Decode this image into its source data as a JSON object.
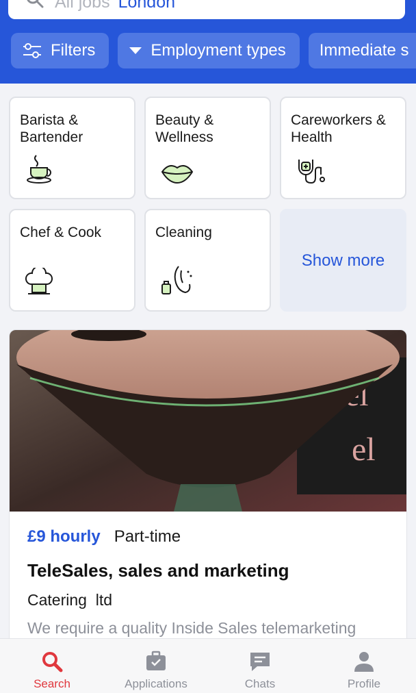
{
  "search": {
    "query": "All jobs",
    "location": "London"
  },
  "filters": [
    {
      "label": "Filters",
      "icon": "sliders-icon"
    },
    {
      "label": "Employment types",
      "icon": "caret-down-icon"
    },
    {
      "label": "Immediate s"
    }
  ],
  "categories": [
    {
      "label": "Barista & Bartender",
      "icon": "coffee-cup-icon"
    },
    {
      "label": "Beauty & Wellness",
      "icon": "lips-icon"
    },
    {
      "label": "Careworkers & Health",
      "icon": "stethoscope-icon"
    },
    {
      "label": "Chef & Cook",
      "icon": "chef-hat-icon"
    },
    {
      "label": "Cleaning",
      "icon": "cleaning-spray-icon"
    },
    {
      "label": "Show more"
    }
  ],
  "job": {
    "pay": "£9 hourly",
    "type": "Part-time",
    "title": "TeleSales, sales and marketing",
    "company": "Catering  ltd",
    "description": "We require a quality Inside Sales telemarketing"
  },
  "tabs": [
    {
      "label": "Search",
      "icon": "search-icon",
      "active": true
    },
    {
      "label": "Applications",
      "icon": "briefcase-icon"
    },
    {
      "label": "Chats",
      "icon": "chat-icon"
    },
    {
      "label": "Profile",
      "icon": "person-icon"
    }
  ],
  "colors": {
    "brand": "#2656d9",
    "active_tab": "#e0383e"
  }
}
